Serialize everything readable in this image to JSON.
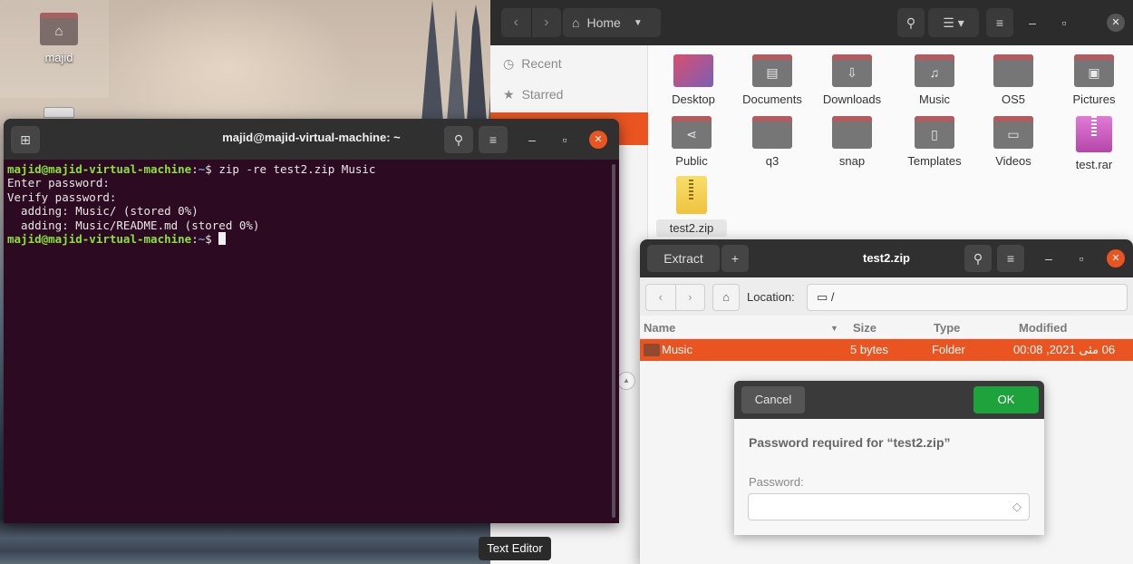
{
  "desktop": {
    "home_icon_label": "majid"
  },
  "files": {
    "path_button": "Home",
    "sidebar": [
      {
        "label": "Recent",
        "icon": "clock-icon"
      },
      {
        "label": "Starred",
        "icon": "star-icon"
      }
    ],
    "items": [
      {
        "label": "Desktop",
        "kind": "folder",
        "glyph": ""
      },
      {
        "label": "Documents",
        "kind": "folder",
        "glyph": "▤"
      },
      {
        "label": "Downloads",
        "kind": "folder",
        "glyph": "⇩"
      },
      {
        "label": "Music",
        "kind": "folder",
        "glyph": "♫"
      },
      {
        "label": "OS5",
        "kind": "folder",
        "glyph": ""
      },
      {
        "label": "Pictures",
        "kind": "folder",
        "glyph": "▣"
      },
      {
        "label": "Public",
        "kind": "folder",
        "glyph": "⋖"
      },
      {
        "label": "q3",
        "kind": "folder",
        "glyph": ""
      },
      {
        "label": "snap",
        "kind": "folder",
        "glyph": ""
      },
      {
        "label": "Templates",
        "kind": "folder",
        "glyph": "▯"
      },
      {
        "label": "Videos",
        "kind": "folder",
        "glyph": "▭"
      },
      {
        "label": "test.rar",
        "kind": "rar",
        "glyph": ""
      },
      {
        "label": "test2.zip",
        "kind": "zip",
        "glyph": ""
      }
    ]
  },
  "terminal": {
    "title": "majid@majid-virtual-machine: ~",
    "prompt_user": "majid@majid-virtual-machine",
    "prompt_sep": ":",
    "prompt_path": "~",
    "prompt_dollar": "$ ",
    "command": "zip -re test2.zip Music",
    "output": [
      "Enter password:",
      "Verify password:",
      "  adding: Music/ (stored 0%)",
      "  adding: Music/README.md (stored 0%)"
    ]
  },
  "tooltip": "Text Editor",
  "archive": {
    "title": "test2.zip",
    "extract_label": "Extract",
    "add_label": "+",
    "location_label": "Location:",
    "location_value": "/",
    "columns": {
      "name": "Name",
      "size": "Size",
      "type": "Type",
      "modified": "Modified"
    },
    "rows": [
      {
        "name": "Music",
        "size": "5 bytes",
        "type": "Folder",
        "modified": "06 مئی 2021, 00:08"
      }
    ]
  },
  "dialog": {
    "cancel_label": "Cancel",
    "ok_label": "OK",
    "message": "Password required for “test2.zip”",
    "password_label": "Password:",
    "password_value": ""
  },
  "colors": {
    "accent_orange": "#e95420",
    "ok_green": "#1ea33c",
    "terminal_bg": "#2c0a22",
    "prompt_green": "#8ae234",
    "prompt_blue": "#729fcf"
  }
}
